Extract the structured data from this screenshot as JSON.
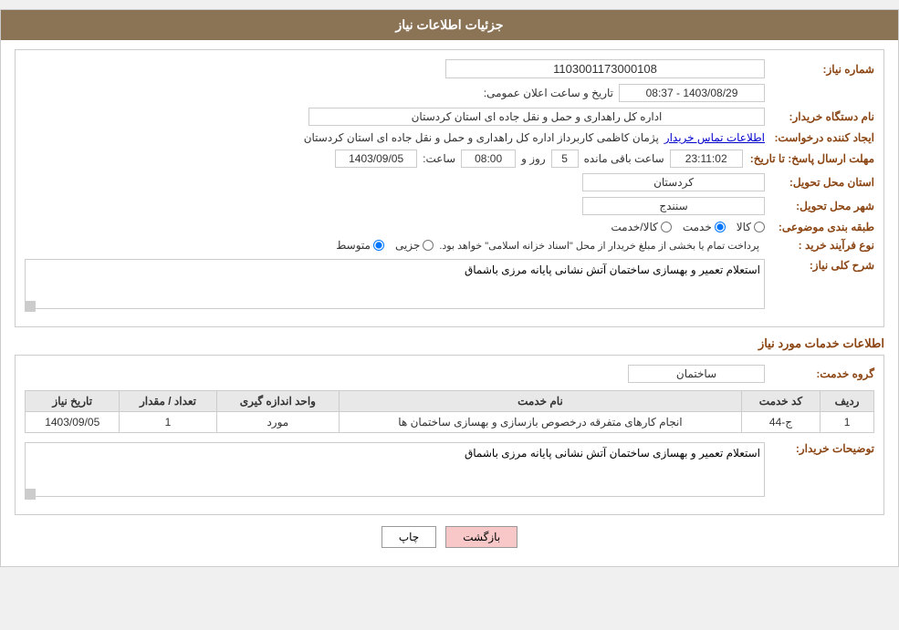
{
  "header": {
    "title": "جزئیات اطلاعات نیاز"
  },
  "fields": {
    "shomareNiaz_label": "شماره نیاز:",
    "shomareNiaz_value": "1103001173000108",
    "namDastgah_label": "نام دستگاه خریدار:",
    "namDastgah_value": "اداره کل راهداری و حمل و نقل جاده ای استان کردستان",
    "tarikhLabel": "تاریخ و ساعت اعلان عمومی:",
    "tarikhValue": "1403/08/29 - 08:37",
    "ijadKonande_label": "ایجاد کننده درخواست:",
    "ijadKonande_value": "پژمان کاظمی کاربرداز اداره کل راهداری و حمل و نقل جاده ای استان کردستان",
    "contactLink": "اطلاعات تماس خریدار",
    "mohlatLabel": "مهلت ارسال پاسخ: تا تاریخ:",
    "dateValue": "1403/09/05",
    "saatLabel": "ساعت:",
    "saatValue": "08:00",
    "rozValue": "5",
    "rozLabel": "روز و",
    "countdownValue": "23:11:02",
    "countdownLabel": "ساعت باقی مانده",
    "ostanLabel": "استان محل تحویل:",
    "ostanValue": "کردستان",
    "shahrLabel": "شهر محل تحویل:",
    "shahrValue": "سنندج",
    "tabaqeLabel": "طبقه بندی موضوعی:",
    "tabaqeOptions": [
      {
        "label": "کالا",
        "selected": false
      },
      {
        "label": "خدمت",
        "selected": true
      },
      {
        "label": "کالا/خدمت",
        "selected": false
      }
    ],
    "naveFarayand_label": "نوع فرآیند خرید :",
    "naveFarayandOptions": [
      {
        "label": "جزیی",
        "selected": false
      },
      {
        "label": "متوسط",
        "selected": true
      }
    ],
    "naveFarayandText": "پرداخت تمام یا بخشی از مبلغ خریدار از محل \"اسناد خزانه اسلامی\" خواهد بود.",
    "sharhLabel": "شرح کلی نیاز:",
    "sharhValue": "استعلام تعمیر و بهسازی ساختمان آتش نشانی پایانه مرزی باشماق",
    "servicesTitle": "اطلاعات خدمات مورد نیاز",
    "groupeKhadamat_label": "گروه خدمت:",
    "groupeKhadamat_value": "ساختمان",
    "table": {
      "headers": [
        "ردیف",
        "کد خدمت",
        "نام خدمت",
        "واحد اندازه گیری",
        "تعداد / مقدار",
        "تاریخ نیاز"
      ],
      "rows": [
        {
          "row": "1",
          "code": "ج-44",
          "name": "انجام کارهای متفرقه درخصوص بازسازی و بهسازی ساختمان ها",
          "unit": "مورد",
          "count": "1",
          "date": "1403/09/05"
        }
      ]
    },
    "descriptionLabel": "توضیحات خریدار:",
    "descriptionValue": "استعلام تعمیر و بهسازی ساختمان آتش نشانی پایانه مرزی باشماق"
  },
  "buttons": {
    "print": "چاپ",
    "back": "بازگشت"
  }
}
